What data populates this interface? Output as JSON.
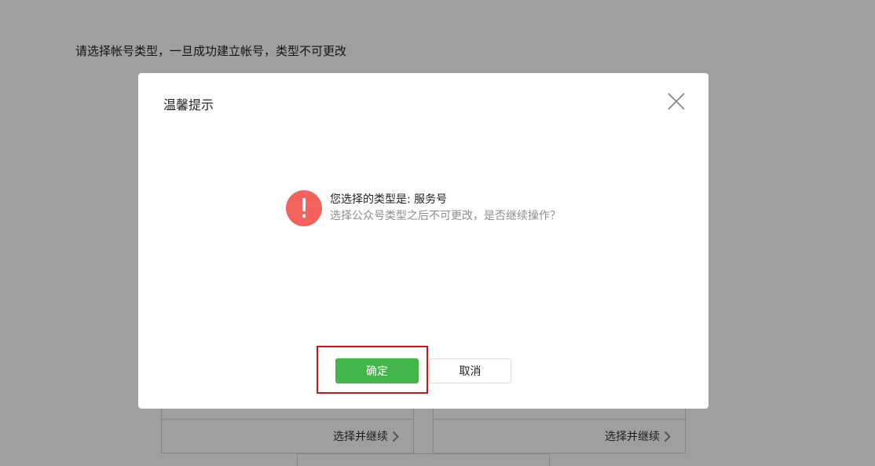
{
  "page": {
    "heading": "请选择帐号类型，一旦成功建立帐号，类型不可更改",
    "cards": [
      {
        "link_label": "选择并继续"
      },
      {
        "link_label": "选择并继续"
      }
    ]
  },
  "dialog": {
    "title": "温馨提示",
    "message_primary": "您选择的类型是: 服务号",
    "message_secondary": "选择公众号类型之后不可更改，是否继续操作？",
    "confirm_label": "确定",
    "cancel_label": "取消",
    "icons": {
      "close": "close-icon",
      "warning": "exclamation-icon"
    }
  },
  "colors": {
    "confirm_green": "#44b549",
    "warning_red": "#f4625d",
    "highlight_red": "#c8161d",
    "overlay": "rgba(0,0,0,0.375)"
  }
}
